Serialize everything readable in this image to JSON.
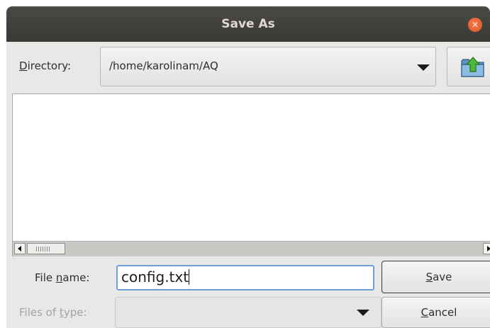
{
  "window": {
    "title": "Save As"
  },
  "directory": {
    "label_mnemonic": "D",
    "label_rest": "irectory:",
    "value": "/home/karolinam/AQ"
  },
  "up_folder_icon": "folder-up-arrow-icon",
  "file_name": {
    "label_prefix": "File ",
    "label_mnemonic": "n",
    "label_rest": "ame:",
    "value": "config.txt"
  },
  "files_of_type": {
    "label_prefix": "Files of ",
    "label_mnemonic": "t",
    "label_rest": "ype:",
    "value": ""
  },
  "buttons": {
    "save_mnemonic": "S",
    "save_rest": "ave",
    "cancel_mnemonic": "C",
    "cancel_rest": "ancel"
  },
  "colors": {
    "titlebar": "#3e3d39",
    "close_button": "#e95420",
    "input_focus_border": "#6c9fd6",
    "window_bg": "#e8e8e7"
  }
}
